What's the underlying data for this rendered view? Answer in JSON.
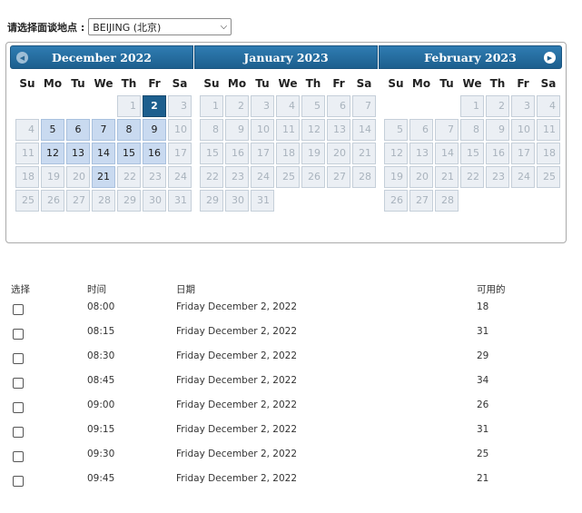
{
  "location": {
    "label": "请选择面谈地点 :",
    "selected": "BEIJING (北京)"
  },
  "calendar": {
    "prev_icon": "triangle-left",
    "next_icon": "triangle-right",
    "weekdays": [
      "Su",
      "Mo",
      "Tu",
      "We",
      "Th",
      "Fr",
      "Sa"
    ],
    "months": [
      {
        "title": "December 2022",
        "cells": [
          {
            "t": ""
          },
          {
            "t": ""
          },
          {
            "t": ""
          },
          {
            "t": ""
          },
          {
            "t": "1",
            "s": "d"
          },
          {
            "t": "2",
            "s": "sel"
          },
          {
            "t": "3",
            "s": "d"
          },
          {
            "t": "4",
            "s": "d"
          },
          {
            "t": "5",
            "s": "a"
          },
          {
            "t": "6",
            "s": "a"
          },
          {
            "t": "7",
            "s": "a"
          },
          {
            "t": "8",
            "s": "a"
          },
          {
            "t": "9",
            "s": "a"
          },
          {
            "t": "10",
            "s": "d"
          },
          {
            "t": "11",
            "s": "d"
          },
          {
            "t": "12",
            "s": "a"
          },
          {
            "t": "13",
            "s": "a"
          },
          {
            "t": "14",
            "s": "a"
          },
          {
            "t": "15",
            "s": "a"
          },
          {
            "t": "16",
            "s": "a"
          },
          {
            "t": "17",
            "s": "d"
          },
          {
            "t": "18",
            "s": "d"
          },
          {
            "t": "19",
            "s": "d"
          },
          {
            "t": "20",
            "s": "d"
          },
          {
            "t": "21",
            "s": "a"
          },
          {
            "t": "22",
            "s": "d"
          },
          {
            "t": "23",
            "s": "d"
          },
          {
            "t": "24",
            "s": "d"
          },
          {
            "t": "25",
            "s": "d"
          },
          {
            "t": "26",
            "s": "d"
          },
          {
            "t": "27",
            "s": "d"
          },
          {
            "t": "28",
            "s": "d"
          },
          {
            "t": "29",
            "s": "d"
          },
          {
            "t": "30",
            "s": "d"
          },
          {
            "t": "31",
            "s": "d"
          }
        ]
      },
      {
        "title": "January 2023",
        "cells": [
          {
            "t": "1",
            "s": "d"
          },
          {
            "t": "2",
            "s": "d"
          },
          {
            "t": "3",
            "s": "d"
          },
          {
            "t": "4",
            "s": "d"
          },
          {
            "t": "5",
            "s": "d"
          },
          {
            "t": "6",
            "s": "d"
          },
          {
            "t": "7",
            "s": "d"
          },
          {
            "t": "8",
            "s": "d"
          },
          {
            "t": "9",
            "s": "d"
          },
          {
            "t": "10",
            "s": "d"
          },
          {
            "t": "11",
            "s": "d"
          },
          {
            "t": "12",
            "s": "d"
          },
          {
            "t": "13",
            "s": "d"
          },
          {
            "t": "14",
            "s": "d"
          },
          {
            "t": "15",
            "s": "d"
          },
          {
            "t": "16",
            "s": "d"
          },
          {
            "t": "17",
            "s": "d"
          },
          {
            "t": "18",
            "s": "d"
          },
          {
            "t": "19",
            "s": "d"
          },
          {
            "t": "20",
            "s": "d"
          },
          {
            "t": "21",
            "s": "d"
          },
          {
            "t": "22",
            "s": "d"
          },
          {
            "t": "23",
            "s": "d"
          },
          {
            "t": "24",
            "s": "d"
          },
          {
            "t": "25",
            "s": "d"
          },
          {
            "t": "26",
            "s": "d"
          },
          {
            "t": "27",
            "s": "d"
          },
          {
            "t": "28",
            "s": "d"
          },
          {
            "t": "29",
            "s": "d"
          },
          {
            "t": "30",
            "s": "d"
          },
          {
            "t": "31",
            "s": "d"
          }
        ]
      },
      {
        "title": "February 2023",
        "cells": [
          {
            "t": ""
          },
          {
            "t": ""
          },
          {
            "t": ""
          },
          {
            "t": "1",
            "s": "d"
          },
          {
            "t": "2",
            "s": "d"
          },
          {
            "t": "3",
            "s": "d"
          },
          {
            "t": "4",
            "s": "d"
          },
          {
            "t": "5",
            "s": "d"
          },
          {
            "t": "6",
            "s": "d"
          },
          {
            "t": "7",
            "s": "d"
          },
          {
            "t": "8",
            "s": "d"
          },
          {
            "t": "9",
            "s": "d"
          },
          {
            "t": "10",
            "s": "d"
          },
          {
            "t": "11",
            "s": "d"
          },
          {
            "t": "12",
            "s": "d"
          },
          {
            "t": "13",
            "s": "d"
          },
          {
            "t": "14",
            "s": "d"
          },
          {
            "t": "15",
            "s": "d"
          },
          {
            "t": "16",
            "s": "d"
          },
          {
            "t": "17",
            "s": "d"
          },
          {
            "t": "18",
            "s": "d"
          },
          {
            "t": "19",
            "s": "d"
          },
          {
            "t": "20",
            "s": "d"
          },
          {
            "t": "21",
            "s": "d"
          },
          {
            "t": "22",
            "s": "d"
          },
          {
            "t": "23",
            "s": "d"
          },
          {
            "t": "24",
            "s": "d"
          },
          {
            "t": "25",
            "s": "d"
          },
          {
            "t": "26",
            "s": "d"
          },
          {
            "t": "27",
            "s": "d"
          },
          {
            "t": "28",
            "s": "d"
          }
        ]
      }
    ]
  },
  "table": {
    "headers": [
      "选择",
      "时间",
      "日期",
      "可用的"
    ],
    "rows": [
      {
        "time": "08:00",
        "date": "Friday December 2, 2022",
        "available": "18"
      },
      {
        "time": "08:15",
        "date": "Friday December 2, 2022",
        "available": "31"
      },
      {
        "time": "08:30",
        "date": "Friday December 2, 2022",
        "available": "29"
      },
      {
        "time": "08:45",
        "date": "Friday December 2, 2022",
        "available": "34"
      },
      {
        "time": "09:00",
        "date": "Friday December 2, 2022",
        "available": "26"
      },
      {
        "time": "09:15",
        "date": "Friday December 2, 2022",
        "available": "31"
      },
      {
        "time": "09:30",
        "date": "Friday December 2, 2022",
        "available": "25"
      },
      {
        "time": "09:45",
        "date": "Friday December 2, 2022",
        "available": "21"
      }
    ]
  }
}
